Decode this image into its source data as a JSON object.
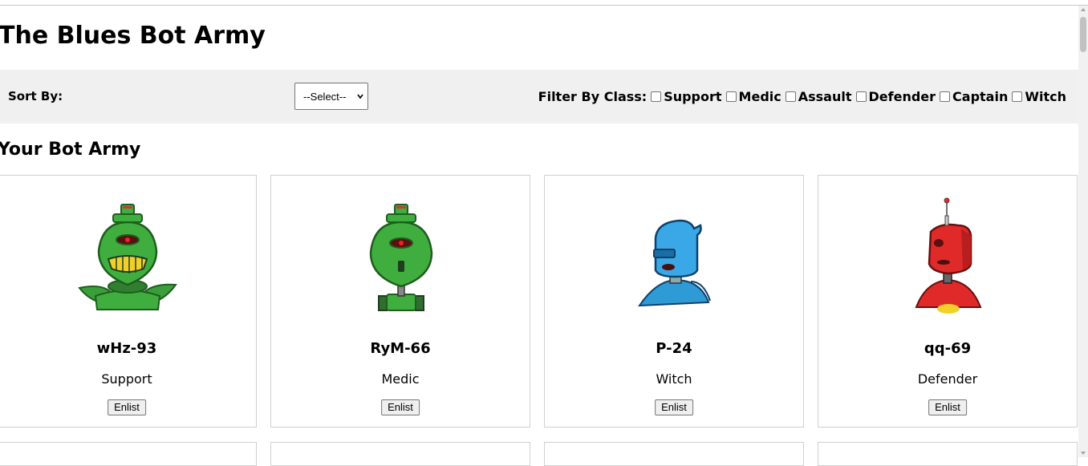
{
  "page": {
    "title": "The Blues Bot Army"
  },
  "toolbar": {
    "sort_label": "Sort By:",
    "sort_selected": "--Select--",
    "filter_label": "Filter By Class:",
    "filter_options": [
      "Support",
      "Medic",
      "Assault",
      "Defender",
      "Captain",
      "Witch"
    ]
  },
  "army": {
    "heading": "Your Bot Army",
    "bots": [
      {
        "name": "wHz-93",
        "bot_class": "Support",
        "enlist_label": "Enlist",
        "avatar": "green-robot-grin-icon"
      },
      {
        "name": "RyM-66",
        "bot_class": "Medic",
        "enlist_label": "Enlist",
        "avatar": "green-robot-icon"
      },
      {
        "name": "P-24",
        "bot_class": "Witch",
        "enlist_label": "Enlist",
        "avatar": "blue-robot-icon"
      },
      {
        "name": "qq-69",
        "bot_class": "Defender",
        "enlist_label": "Enlist",
        "avatar": "red-robot-icon"
      }
    ]
  }
}
